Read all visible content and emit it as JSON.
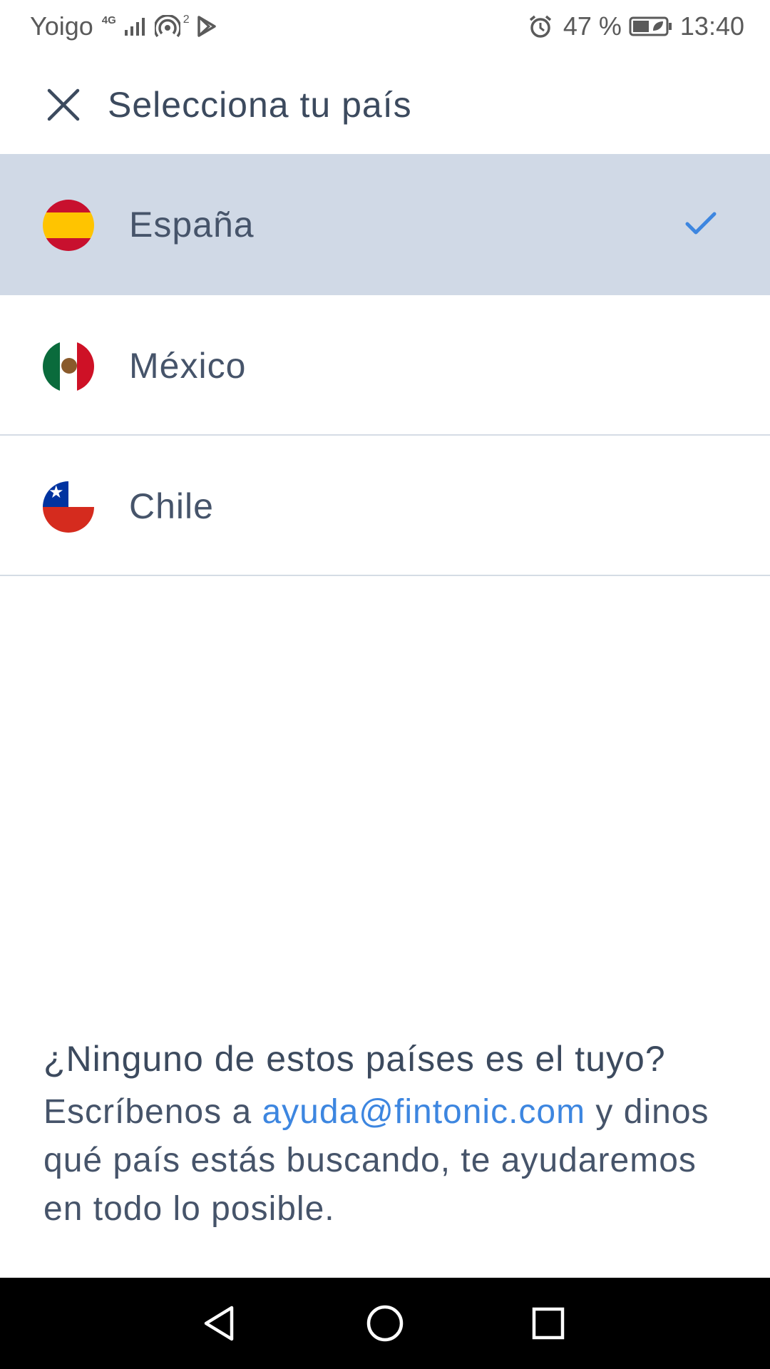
{
  "status_bar": {
    "carrier": "Yoigo",
    "network_type": "4G",
    "hotspot_count": "2",
    "battery": "47 %",
    "time": "13:40"
  },
  "header": {
    "title": "Selecciona tu país",
    "close_icon": "close-icon"
  },
  "countries": [
    {
      "name": "España",
      "flag": "spain-flag-icon",
      "selected": true
    },
    {
      "name": "México",
      "flag": "mexico-flag-icon",
      "selected": false
    },
    {
      "name": "Chile",
      "flag": "chile-flag-icon",
      "selected": false
    }
  ],
  "help": {
    "title": "¿Ninguno de estos países es el tuyo?",
    "text_before": "Escríbenos a ",
    "email": "ayuda@fintonic.com",
    "text_after": " y dinos qué país estás buscando, te ayudaremos en todo lo posible."
  },
  "colors": {
    "selected_row_bg": "#d0d9e6",
    "accent": "#3d86e0",
    "text": "#46546a"
  }
}
